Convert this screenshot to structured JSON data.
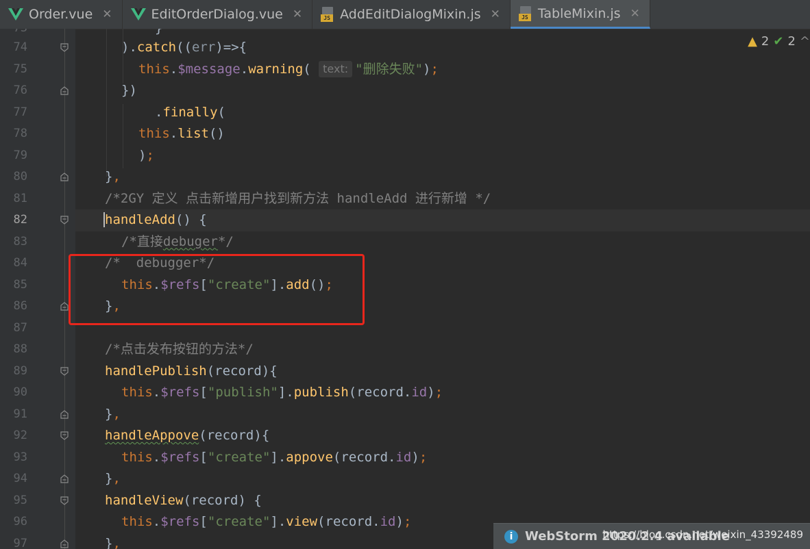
{
  "tabs": [
    {
      "label": "Order.vue",
      "icon": "vue-icon",
      "active": false
    },
    {
      "label": "EditOrderDialog.vue",
      "icon": "vue-icon",
      "active": false
    },
    {
      "label": "AddEditDialogMixin.js",
      "icon": "js-file-icon",
      "active": false
    },
    {
      "label": "TableMixin.js",
      "icon": "js-file-icon",
      "active": true
    }
  ],
  "inspections": {
    "warnings": "2",
    "weak_warnings": "2",
    "more": "^"
  },
  "editor": {
    "current_line": "82",
    "param_hint": "text:",
    "lines": [
      {
        "num": "74"
      },
      {
        "num": "75"
      },
      {
        "num": "76"
      },
      {
        "num": "77"
      },
      {
        "num": "78"
      },
      {
        "num": "79"
      },
      {
        "num": "80"
      },
      {
        "num": "81"
      },
      {
        "num": "82"
      },
      {
        "num": "83"
      },
      {
        "num": "84"
      },
      {
        "num": "85"
      },
      {
        "num": "86"
      },
      {
        "num": "87"
      },
      {
        "num": "88"
      },
      {
        "num": "89"
      },
      {
        "num": "90"
      },
      {
        "num": "91"
      },
      {
        "num": "92"
      },
      {
        "num": "93"
      },
      {
        "num": "94"
      },
      {
        "num": "95"
      },
      {
        "num": "96"
      },
      {
        "num": "97"
      }
    ],
    "text": {
      "l74_catch": "catch",
      "l74_err": "err",
      "l75_this": "this",
      "l75_message": "$message",
      "l75_warning": "warning",
      "l75_str": "\"删除失败\"",
      "l77_finally": "finally",
      "l78_this": "this",
      "l78_list": "list",
      "l81_comment": "/*2GY 定义 点击新增用户找到新方法 handleAdd 进行新增 */",
      "l82_fn": "handleAdd",
      "l83_comment_a": "/*直接",
      "l83_comment_b": "debuger",
      "l83_comment_c": "*/",
      "l84_comment": "/*  debugger*/",
      "l85_this": "this",
      "l85_refs": "$refs",
      "l85_str": "\"create\"",
      "l85_add": "add",
      "l88_comment": "/*点击发布按钮的方法*/",
      "l89_fn": "handlePublish",
      "l89_param": "record",
      "l90_this": "this",
      "l90_refs": "$refs",
      "l90_str": "\"publish\"",
      "l90_fn": "publish",
      "l90_arg": "record",
      "l90_id": "id",
      "l92_fn": "handleAppove",
      "l92_param": "record",
      "l93_this": "this",
      "l93_refs": "$refs",
      "l93_str": "\"create\"",
      "l93_fn": "appove",
      "l93_arg": "record",
      "l93_id": "id",
      "l95_fn": "handleView",
      "l95_param": "record",
      "l96_this": "this",
      "l96_refs": "$refs",
      "l96_str": "\"create\"",
      "l96_fn": "view",
      "l96_arg": "record",
      "l96_id": "id"
    }
  },
  "notification": {
    "title": "WebStorm 2020.2.4 available"
  },
  "watermark": "https://blog.csdn.net/weixin_43392489",
  "colors": {
    "background": "#2b2b2b",
    "keyword": "#cc7832",
    "function": "#ffc66d",
    "property": "#9876aa",
    "string": "#6a8759",
    "comment": "#808080",
    "highlight_box": "#e8261c"
  }
}
